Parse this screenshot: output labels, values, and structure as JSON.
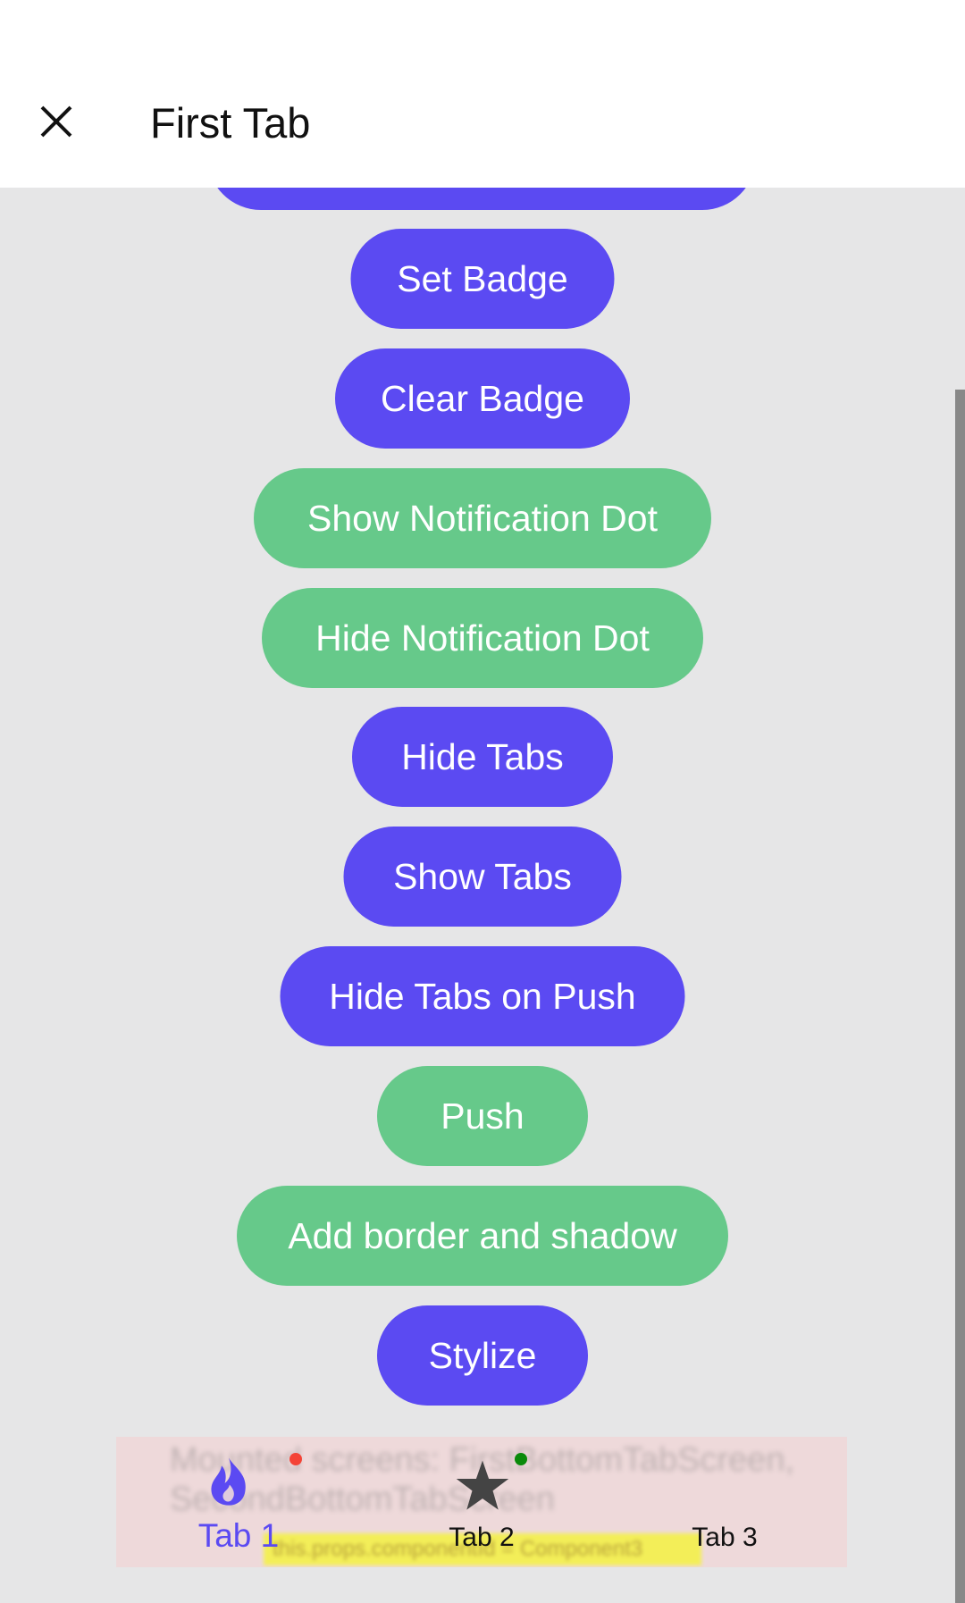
{
  "header": {
    "title": "First Tab",
    "close_icon": "close-icon"
  },
  "buttons": [
    {
      "label": "Set Badge",
      "color": "#5b4af2"
    },
    {
      "label": "Clear Badge",
      "color": "#5b4af2"
    },
    {
      "label": "Show Notification Dot",
      "color": "#66c98a"
    },
    {
      "label": "Hide Notification Dot",
      "color": "#66c98a"
    },
    {
      "label": "Hide Tabs",
      "color": "#5b4af2"
    },
    {
      "label": "Show Tabs",
      "color": "#5b4af2"
    },
    {
      "label": "Hide Tabs on Push",
      "color": "#5b4af2"
    },
    {
      "label": "Push",
      "color": "#66c98a"
    },
    {
      "label": "Add border and shadow",
      "color": "#66c98a"
    },
    {
      "label": "Stylize",
      "color": "#5b4af2"
    }
  ],
  "tabbar": {
    "background_text": "Mounted screens: FirstBottomTabScreen, SecondBottomTabScreen",
    "hint_text": "this.props.componentId = Component3",
    "tabs": [
      {
        "label": "Tab 1",
        "icon": "flame-icon",
        "active": true,
        "dot_color": "#f44336"
      },
      {
        "label": "Tab 2",
        "icon": "star-icon",
        "active": false,
        "dot_color": "#0a8a0a"
      },
      {
        "label": "Tab 3",
        "icon": "",
        "active": false
      }
    ],
    "active_color": "#5b4af2",
    "inactive_color": "#111111"
  }
}
